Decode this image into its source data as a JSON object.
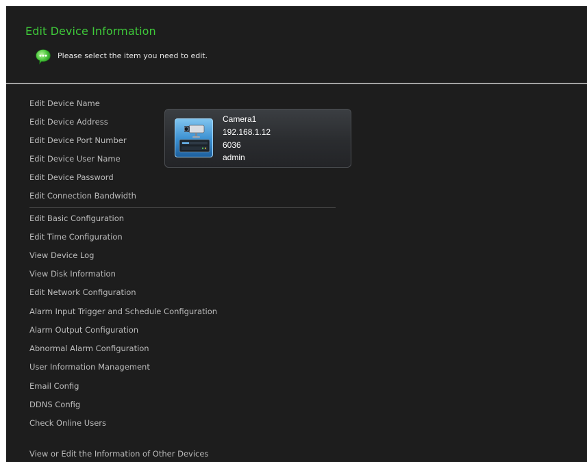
{
  "header": {
    "title": "Edit Device Information",
    "hint": "Please select the item you need to edit."
  },
  "menu": {
    "connection_items": [
      "Edit Device Name",
      "Edit Device Address",
      "Edit Device Port Number",
      "Edit Device User Name",
      "Edit Device Password",
      "Edit Connection Bandwidth"
    ],
    "config_items": [
      "Edit Basic Configuration",
      "Edit Time Configuration",
      "View Device Log",
      "View Disk Information",
      "Edit Network Configuration",
      "Alarm Input Trigger and Schedule Configuration",
      "Alarm Output Configuration",
      "Abnormal Alarm Configuration",
      "User Information Management",
      "Email Config",
      "DDNS Config",
      "Check Online Users"
    ],
    "other_devices": "View or Edit the Information of Other Devices"
  },
  "device": {
    "name": "Camera1",
    "address": "192.168.1.12",
    "port": "6036",
    "user": "admin"
  },
  "colors": {
    "background": "#1d1d1d",
    "title": "#3fc93a",
    "menu_text": "#bcbcbc",
    "hint_icon": "#5fd34a"
  },
  "icons": {
    "hint": "speech-bubble-icon",
    "device": "ip-camera-nvr-icon"
  }
}
